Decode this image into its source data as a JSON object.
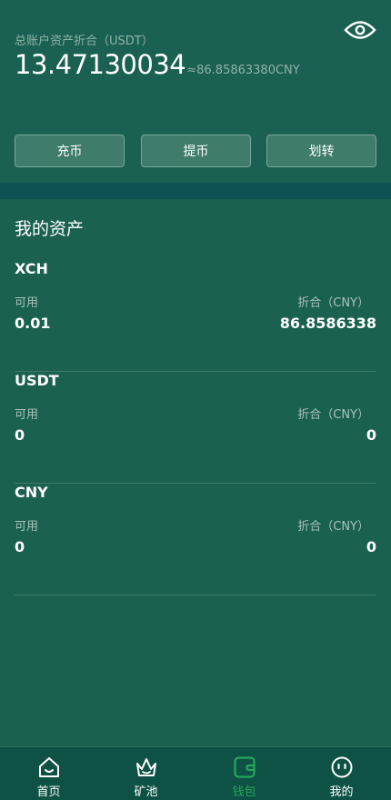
{
  "header": {
    "total_label": "总账户资产折合（USDT）",
    "total_amount": "13.47130034",
    "total_cny": "≈86.85863380CNY"
  },
  "actions": {
    "deposit": "充币",
    "withdraw": "提币",
    "transfer": "划转"
  },
  "assets": {
    "title": "我的资产",
    "items": [
      {
        "name": "XCH",
        "available_label": "可用",
        "cny_label": "折合（CNY）",
        "available": "0.01",
        "cny": "86.8586338"
      },
      {
        "name": "USDT",
        "available_label": "可用",
        "cny_label": "折合（CNY）",
        "available": "0",
        "cny": "0"
      },
      {
        "name": "CNY",
        "available_label": "可用",
        "cny_label": "折合（CNY）",
        "available": "0",
        "cny": "0"
      }
    ]
  },
  "nav": {
    "items": [
      {
        "label": "首页",
        "icon": "home-icon"
      },
      {
        "label": "矿池",
        "icon": "crown-icon"
      },
      {
        "label": "钱包",
        "icon": "wallet-icon"
      },
      {
        "label": "我的",
        "icon": "profile-face-icon"
      }
    ],
    "active_index": 2,
    "active_color": "#26a65b"
  }
}
